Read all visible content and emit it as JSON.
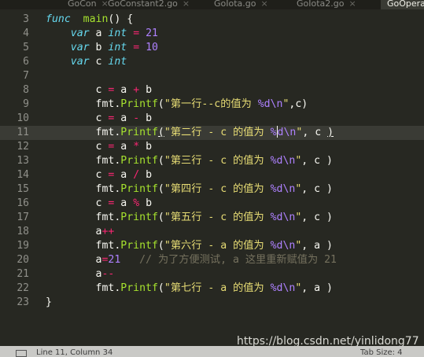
{
  "tabs": [
    {
      "label": "GoCon",
      "active": false
    },
    {
      "label": "GoConstant2.go",
      "active": false
    },
    {
      "label": "GoIota.go",
      "active": false
    },
    {
      "label": "GoIota2.go",
      "active": false
    },
    {
      "label": "GoOpera",
      "active": true
    }
  ],
  "tab_close_glyph": "×",
  "current_line": 11,
  "lines": [
    {
      "n": "3",
      "tokens": [
        [
          "kw",
          "func"
        ],
        [
          "",
          "  "
        ],
        [
          "fn",
          "main"
        ],
        [
          "",
          "() {"
        ]
      ]
    },
    {
      "n": "4",
      "tokens": [
        [
          "",
          "    "
        ],
        [
          "kw",
          "var"
        ],
        [
          "",
          " a "
        ],
        [
          "ty",
          "int"
        ],
        [
          "",
          " "
        ],
        [
          "op",
          "="
        ],
        [
          "",
          " "
        ],
        [
          "num",
          "21"
        ]
      ]
    },
    {
      "n": "5",
      "tokens": [
        [
          "",
          "    "
        ],
        [
          "kw",
          "var"
        ],
        [
          "",
          " b "
        ],
        [
          "ty",
          "int"
        ],
        [
          "",
          " "
        ],
        [
          "op",
          "="
        ],
        [
          "",
          " "
        ],
        [
          "num",
          "10"
        ]
      ]
    },
    {
      "n": "6",
      "tokens": [
        [
          "",
          "    "
        ],
        [
          "kw",
          "var"
        ],
        [
          "",
          " c "
        ],
        [
          "ty",
          "int"
        ]
      ]
    },
    {
      "n": "7",
      "tokens": []
    },
    {
      "n": "8",
      "tokens": [
        [
          "",
          "        c "
        ],
        [
          "op",
          "="
        ],
        [
          "",
          " a "
        ],
        [
          "op",
          "+"
        ],
        [
          "",
          " b"
        ]
      ]
    },
    {
      "n": "9",
      "tokens": [
        [
          "",
          "        fmt."
        ],
        [
          "fn",
          "Printf"
        ],
        [
          "",
          "("
        ],
        [
          "str",
          "\"第一行--c的值为 "
        ],
        [
          "fmt",
          "%d\\n"
        ],
        [
          "str",
          "\""
        ],
        [
          "",
          ",c)"
        ]
      ]
    },
    {
      "n": "10",
      "tokens": [
        [
          "",
          "        c "
        ],
        [
          "op",
          "="
        ],
        [
          "",
          " a "
        ],
        [
          "op",
          "-"
        ],
        [
          "",
          " b"
        ]
      ]
    },
    {
      "n": "11",
      "tokens": [
        [
          "",
          "        fmt."
        ],
        [
          "fn",
          "Printf"
        ],
        [
          "u",
          "("
        ],
        [
          "str",
          "\"第二行 - c 的值为 "
        ],
        [
          "fmt",
          "%"
        ],
        [
          "caret",
          ""
        ],
        [
          "fmt",
          "d\\n"
        ],
        [
          "str",
          "\""
        ],
        [
          "",
          ", c "
        ],
        [
          "u",
          ")"
        ]
      ]
    },
    {
      "n": "12",
      "tokens": [
        [
          "",
          "        c "
        ],
        [
          "op",
          "="
        ],
        [
          "",
          " a "
        ],
        [
          "op",
          "*"
        ],
        [
          "",
          " b"
        ]
      ]
    },
    {
      "n": "13",
      "tokens": [
        [
          "",
          "        fmt."
        ],
        [
          "fn",
          "Printf"
        ],
        [
          "",
          "("
        ],
        [
          "str",
          "\"第三行 - c 的值为 "
        ],
        [
          "fmt",
          "%d\\n"
        ],
        [
          "str",
          "\""
        ],
        [
          "",
          ", c )"
        ]
      ]
    },
    {
      "n": "14",
      "tokens": [
        [
          "",
          "        c "
        ],
        [
          "op",
          "="
        ],
        [
          "",
          " a "
        ],
        [
          "op",
          "/"
        ],
        [
          "",
          " b"
        ]
      ]
    },
    {
      "n": "15",
      "tokens": [
        [
          "",
          "        fmt."
        ],
        [
          "fn",
          "Printf"
        ],
        [
          "",
          "("
        ],
        [
          "str",
          "\"第四行 - c 的值为 "
        ],
        [
          "fmt",
          "%d\\n"
        ],
        [
          "str",
          "\""
        ],
        [
          "",
          ", c )"
        ]
      ]
    },
    {
      "n": "16",
      "tokens": [
        [
          "",
          "        c "
        ],
        [
          "op",
          "="
        ],
        [
          "",
          " a "
        ],
        [
          "op",
          "%"
        ],
        [
          "",
          " b"
        ]
      ]
    },
    {
      "n": "17",
      "tokens": [
        [
          "",
          "        fmt."
        ],
        [
          "fn",
          "Printf"
        ],
        [
          "",
          "("
        ],
        [
          "str",
          "\"第五行 - c 的值为 "
        ],
        [
          "fmt",
          "%d\\n"
        ],
        [
          "str",
          "\""
        ],
        [
          "",
          ", c )"
        ]
      ]
    },
    {
      "n": "18",
      "tokens": [
        [
          "",
          "        a"
        ],
        [
          "op",
          "++"
        ]
      ]
    },
    {
      "n": "19",
      "tokens": [
        [
          "",
          "        fmt."
        ],
        [
          "fn",
          "Printf"
        ],
        [
          "",
          "("
        ],
        [
          "str",
          "\"第六行 - a 的值为 "
        ],
        [
          "fmt",
          "%d\\n"
        ],
        [
          "str",
          "\""
        ],
        [
          "",
          ", a )"
        ]
      ]
    },
    {
      "n": "20",
      "tokens": [
        [
          "",
          "        a"
        ],
        [
          "op",
          "="
        ],
        [
          "num",
          "21"
        ],
        [
          "",
          "   "
        ],
        [
          "cm",
          "// 为了方便测试, a 这里重新赋值为 21"
        ]
      ]
    },
    {
      "n": "21",
      "tokens": [
        [
          "",
          "        a"
        ],
        [
          "op",
          "--"
        ]
      ]
    },
    {
      "n": "22",
      "tokens": [
        [
          "",
          "        fmt."
        ],
        [
          "fn",
          "Printf"
        ],
        [
          "",
          "("
        ],
        [
          "str",
          "\"第七行 - a 的值为 "
        ],
        [
          "fmt",
          "%d\\n"
        ],
        [
          "str",
          "\""
        ],
        [
          "",
          ", a )"
        ]
      ]
    },
    {
      "n": "23",
      "tokens": [
        [
          "",
          "}"
        ]
      ]
    }
  ],
  "status": {
    "position": "Line 11, Column 34",
    "tab_size": "Tab Size: 4"
  },
  "watermark": "https://blog.csdn.net/yinlidong77",
  "colors": {
    "background": "#272822",
    "keyword": "#66d9ef",
    "function": "#a6e22e",
    "number": "#ae81ff",
    "operator": "#f92672",
    "string": "#e6db74",
    "comment": "#75715e"
  }
}
